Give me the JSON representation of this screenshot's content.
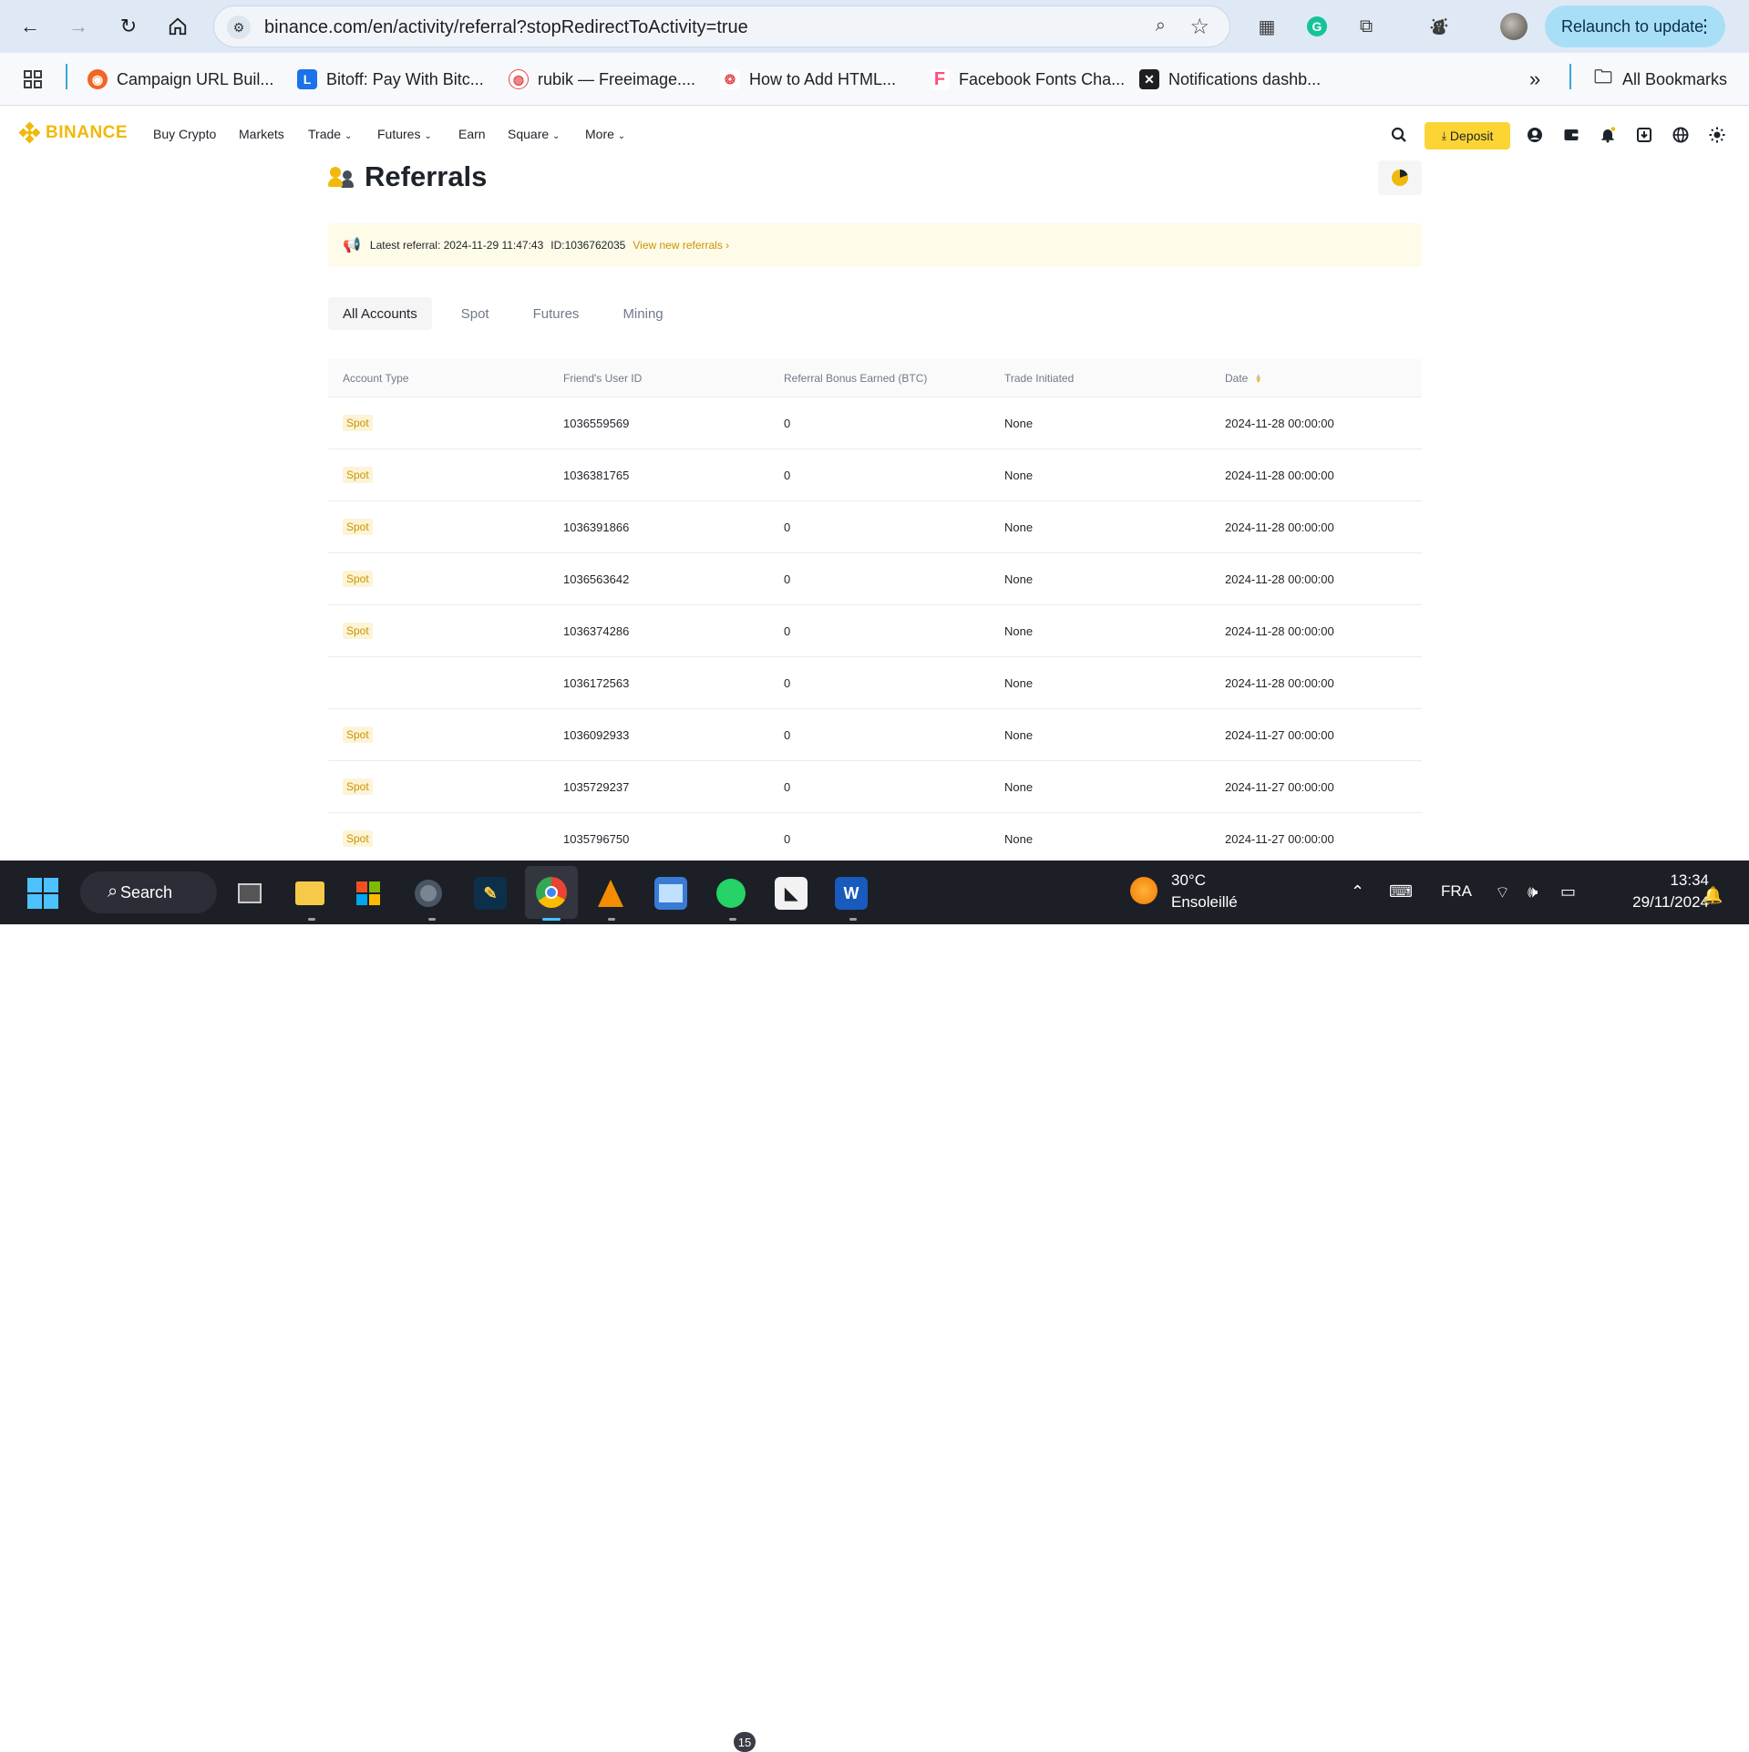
{
  "browser": {
    "url": "binance.com/en/activity/referral?stopRedirectToActivity=true",
    "relaunch_label": "Relaunch to update",
    "bookmarks": [
      {
        "label": "Campaign URL Buil...",
        "color": "#f26522"
      },
      {
        "label": "Bitoff: Pay With Bitc...",
        "color": "#1a73e8"
      },
      {
        "label": "rubik — Freeimage....",
        "color": "#e34d4d"
      },
      {
        "label": "How to Add HTML...",
        "color": "#e34d4d"
      },
      {
        "label": "Facebook Fonts Cha...",
        "color": "#ff4f7b"
      },
      {
        "label": "Notifications dashb...",
        "color": "#1f1f1f"
      }
    ],
    "all_bookmarks_label": "All Bookmarks"
  },
  "binance": {
    "logo_text": "BINANCE",
    "brand_color": "#f0b90b",
    "nav": {
      "buy_crypto": "Buy Crypto",
      "markets": "Markets",
      "trade": "Trade",
      "futures": "Futures",
      "earn": "Earn",
      "square": "Square",
      "more": "More"
    },
    "deposit_label": "Deposit"
  },
  "page": {
    "title": "Referrals",
    "notice": {
      "latest_label": "Latest referral: 2024-11-29 11:47:43",
      "id_label": "ID:1036762035",
      "link_label": "View new referrals ›"
    },
    "tabs": [
      "All Accounts",
      "Spot",
      "Futures",
      "Mining"
    ],
    "active_tab": "All Accounts",
    "table": {
      "headers": [
        "Account Type",
        "Friend's User ID",
        "Referral Bonus Earned (BTC)",
        "Trade Initiated",
        "Date"
      ],
      "rows": [
        {
          "type": "Spot",
          "user_id": "1036559569",
          "bonus": "0",
          "trade": "None",
          "date": "2024-11-28 00:00:00"
        },
        {
          "type": "Spot",
          "user_id": "1036381765",
          "bonus": "0",
          "trade": "None",
          "date": "2024-11-28 00:00:00"
        },
        {
          "type": "Spot",
          "user_id": "1036391866",
          "bonus": "0",
          "trade": "None",
          "date": "2024-11-28 00:00:00"
        },
        {
          "type": "Spot",
          "user_id": "1036563642",
          "bonus": "0",
          "trade": "None",
          "date": "2024-11-28 00:00:00"
        },
        {
          "type": "Spot",
          "user_id": "1036374286",
          "bonus": "0",
          "trade": "None",
          "date": "2024-11-28 00:00:00"
        },
        {
          "type": "",
          "user_id": "1036172563",
          "bonus": "0",
          "trade": "None",
          "date": "2024-11-28 00:00:00"
        },
        {
          "type": "Spot",
          "user_id": "1036092933",
          "bonus": "0",
          "trade": "None",
          "date": "2024-11-27 00:00:00"
        },
        {
          "type": "Spot",
          "user_id": "1035729237",
          "bonus": "0",
          "trade": "None",
          "date": "2024-11-27 00:00:00"
        },
        {
          "type": "Spot",
          "user_id": "1035796750",
          "bonus": "0",
          "trade": "None",
          "date": "2024-11-27 00:00:00"
        }
      ]
    }
  },
  "taskbar": {
    "search_label": "Search",
    "whatsapp_badge": "15",
    "temperature": "30°C",
    "weather": "Ensoleillé",
    "language": "FRA",
    "time": "13:34",
    "date": "29/11/2024"
  }
}
